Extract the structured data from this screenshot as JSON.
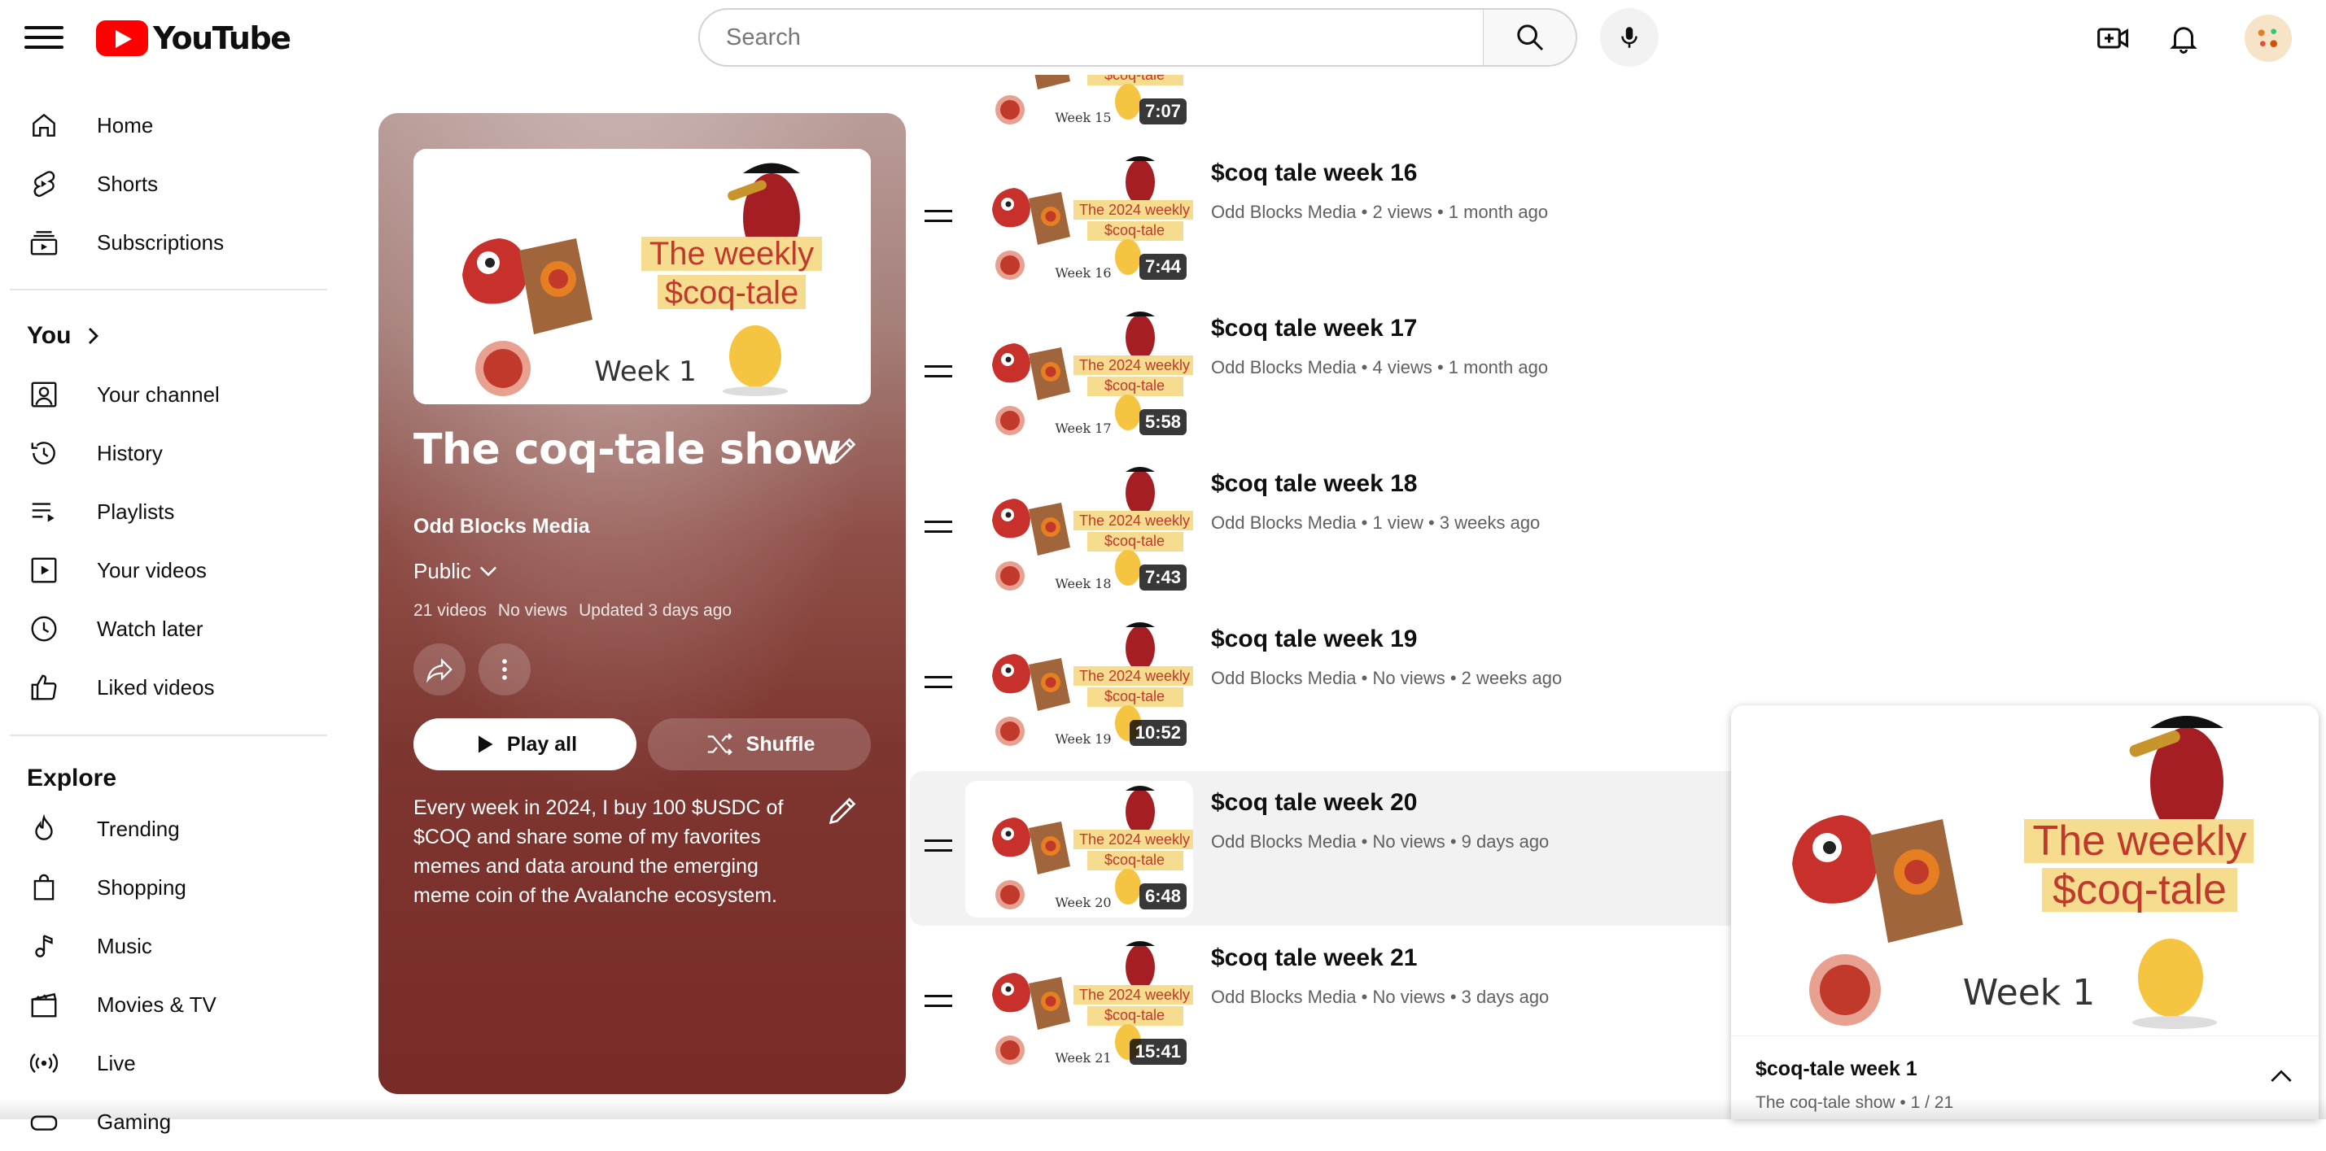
{
  "header": {
    "logo_text": "YouTube",
    "search_placeholder": "Search"
  },
  "sidebar": {
    "main": [
      {
        "label": "Home",
        "icon": "home-icon"
      },
      {
        "label": "Shorts",
        "icon": "shorts-icon"
      },
      {
        "label": "Subscriptions",
        "icon": "subscriptions-icon"
      }
    ],
    "you_heading": "You",
    "you_items": [
      {
        "label": "Your channel",
        "icon": "your-channel-icon"
      },
      {
        "label": "History",
        "icon": "history-icon"
      },
      {
        "label": "Playlists",
        "icon": "playlists-icon"
      },
      {
        "label": "Your videos",
        "icon": "your-videos-icon"
      },
      {
        "label": "Watch later",
        "icon": "watch-later-icon"
      },
      {
        "label": "Liked videos",
        "icon": "liked-videos-icon"
      }
    ],
    "explore_heading": "Explore",
    "explore_items": [
      {
        "label": "Trending",
        "icon": "trending-icon"
      },
      {
        "label": "Shopping",
        "icon": "shopping-icon"
      },
      {
        "label": "Music",
        "icon": "music-icon"
      },
      {
        "label": "Movies & TV",
        "icon": "movies-icon"
      },
      {
        "label": "Live",
        "icon": "live-icon"
      },
      {
        "label": "Gaming",
        "icon": "gaming-icon"
      }
    ]
  },
  "playlist": {
    "title": "The coq-tale show",
    "owner": "Odd Blocks Media",
    "privacy": "Public",
    "video_count": "21 videos",
    "views": "No views",
    "updated": "Updated 3 days ago",
    "play_all_label": "Play all",
    "shuffle_label": "Shuffle",
    "description": "Every week in 2024, I buy 100 $USDC of $COQ and share some of my favorites memes and data around the emerging meme coin of the Avalanche ecosystem.",
    "thumb": {
      "banner_line1": "The weekly",
      "banner_line2": "$coq-tale",
      "week": "Week 1"
    }
  },
  "videos": [
    {
      "title": "",
      "channel": "",
      "views": "",
      "age": "",
      "duration": "7:07",
      "week": "Week 15",
      "banner1": "",
      "banner2": "$coq-tale"
    },
    {
      "title": "$coq tale week 16",
      "channel": "Odd Blocks Media",
      "views": "2 views",
      "age": "1 month ago",
      "duration": "7:44",
      "week": "Week 16",
      "banner1": "The 2024 weekly",
      "banner2": "$coq-tale"
    },
    {
      "title": "$coq tale week 17",
      "channel": "Odd Blocks Media",
      "views": "4 views",
      "age": "1 month ago",
      "duration": "5:58",
      "week": "Week 17",
      "banner1": "The 2024 weekly",
      "banner2": "$coq-tale"
    },
    {
      "title": "$coq tale week 18",
      "channel": "Odd Blocks Media",
      "views": "1 view",
      "age": "3 weeks ago",
      "duration": "7:43",
      "week": "Week 18",
      "banner1": "The 2024 weekly",
      "banner2": "$coq-tale"
    },
    {
      "title": "$coq tale week 19",
      "channel": "Odd Blocks Media",
      "views": "No views",
      "age": "2 weeks ago",
      "duration": "10:52",
      "week": "Week 19",
      "banner1": "The 2024 weekly",
      "banner2": "$coq-tale"
    },
    {
      "title": "$coq tale week 20",
      "channel": "Odd Blocks Media",
      "views": "No views",
      "age": "9 days ago",
      "duration": "6:48",
      "week": "Week 20",
      "banner1": "The 2024 weekly",
      "banner2": "$coq-tale"
    },
    {
      "title": "$coq tale week 21",
      "channel": "Odd Blocks Media",
      "views": "No views",
      "age": "3 days ago",
      "duration": "15:41",
      "week": "Week 21",
      "banner1": "The 2024 weekly",
      "banner2": "$coq-tale"
    }
  ],
  "miniplayer": {
    "title": "$coq-tale week 1",
    "playlist": "The coq-tale show",
    "position": "1 / 21",
    "banner_line1": "The weekly",
    "banner_line2": "$coq-tale",
    "week": "Week 1"
  },
  "colors": {
    "brand_red": "#ff0000",
    "panel_maroon": "#7e3630",
    "banner_yellow": "#f6dc8f",
    "banner_text": "#c0392b"
  }
}
